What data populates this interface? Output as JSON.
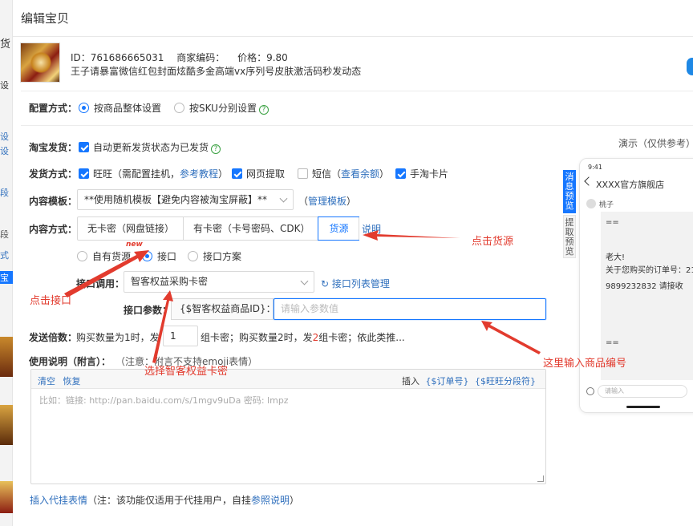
{
  "background": {
    "fragments": [
      "货",
      "设",
      "设",
      "设",
      "段",
      "段",
      "式",
      "宝"
    ]
  },
  "modal": {
    "title": "编辑宝贝",
    "product": {
      "id_label": "ID：761686665031",
      "code_label": "商家编码：",
      "price_label": "价格：9.80",
      "title": "王子请暴富微信红包封面炫酷多金高端vx序列号皮肤激活码秒发动态"
    },
    "config": {
      "label": "配置方式：",
      "options": [
        "按商品整体设置",
        "按SKU分别设置"
      ],
      "selected": "按商品整体设置"
    },
    "taobao_ship": {
      "label": "淘宝发货：",
      "checkbox_label": "自动更新发货状态为已发货",
      "checked": true
    },
    "demo_label": "演示（仅供参考）",
    "ship_method": {
      "label": "发货方式：",
      "wangwang": "旺旺（需配置挂机，",
      "wangwang_link": "参考教程",
      "wangwang_close": "）",
      "web": "网页提取",
      "sms": "短信（",
      "sms_link": "查看余额",
      "sms_close": "）",
      "shoutao": "手淘卡片"
    },
    "content_template": {
      "label": "内容模板：",
      "value": "**使用随机模板【避免内容被淘宝屏蔽】**",
      "manage_prefix": "（",
      "manage_link": "管理模板",
      "manage_suffix": "）"
    },
    "content_method": {
      "label": "内容方式：",
      "tabs": [
        "无卡密（网盘链接）",
        "有卡密（卡号密码、CDK）",
        "货源"
      ],
      "active": "货源",
      "explain_link": "说明"
    },
    "source": {
      "options": [
        "自有货源",
        "接口",
        "接口方案"
      ],
      "selected": "接口",
      "new_tag": "new"
    },
    "api_call": {
      "label": "接口调用：",
      "value": "智客权益采购卡密",
      "manage_link": "接口列表管理"
    },
    "api_param": {
      "label": "接口参数：",
      "addon": "{$智客权益商品ID}：",
      "placeholder": "请输入参数值"
    },
    "multiple": {
      "label": "发送倍数：",
      "text_a": "购买数量为1时，发",
      "value": "1",
      "text_b": "组卡密；购买数量2时，发",
      "highlight": "2",
      "text_c": "组卡密；依此类推..."
    },
    "usage": {
      "label": "使用说明（附言）：",
      "note": "（注意：附言不支持emoji表情）",
      "clear": "清空",
      "restore": "恢复",
      "insert_label": "插入",
      "insert_order": "{$订单号}",
      "insert_ww": "{$旺旺分段符}",
      "placeholder": "比如：链接: http://pan.baidu.com/s/1mgv9uDa 密码: lmpz"
    },
    "footer": {
      "link": "插入代挂表情",
      "note": "（注：该功能仅适用于代挂用户，自挂",
      "note_link": "参照说明",
      "note_close": "）"
    },
    "side_tabs": [
      "消息预览",
      "提取预览"
    ]
  },
  "phone": {
    "time": "9:41",
    "dots": "···",
    "shop": "XXXX官方旗舰店",
    "user": "桃子",
    "lines": [
      "==",
      "老大!",
      "关于您购买的订单号：21...",
      "9899232832 请接收",
      "=="
    ],
    "input_placeholder": "请输入"
  },
  "annotations": {
    "click_source": "点击货源",
    "click_api": "点击接口",
    "choose_api": "选择智客权益卡密",
    "enter_id": "这里输入商品编号"
  },
  "colors": {
    "primary": "#1677ff",
    "link": "#2f6fbd",
    "annotation": "#e23b2e",
    "help": "#3aa142"
  }
}
